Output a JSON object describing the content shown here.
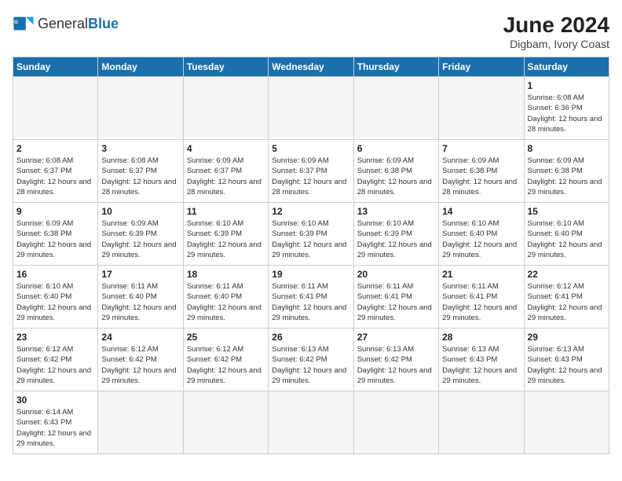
{
  "header": {
    "logo_general": "General",
    "logo_blue": "Blue",
    "title": "June 2024",
    "location": "Digbam, Ivory Coast"
  },
  "days_of_week": [
    "Sunday",
    "Monday",
    "Tuesday",
    "Wednesday",
    "Thursday",
    "Friday",
    "Saturday"
  ],
  "weeks": [
    [
      {
        "day": "",
        "info": ""
      },
      {
        "day": "",
        "info": ""
      },
      {
        "day": "",
        "info": ""
      },
      {
        "day": "",
        "info": ""
      },
      {
        "day": "",
        "info": ""
      },
      {
        "day": "",
        "info": ""
      },
      {
        "day": "1",
        "info": "Sunrise: 6:08 AM\nSunset: 6:36 PM\nDaylight: 12 hours and 28 minutes."
      }
    ],
    [
      {
        "day": "2",
        "info": "Sunrise: 6:08 AM\nSunset: 6:37 PM\nDaylight: 12 hours and 28 minutes."
      },
      {
        "day": "3",
        "info": "Sunrise: 6:08 AM\nSunset: 6:37 PM\nDaylight: 12 hours and 28 minutes."
      },
      {
        "day": "4",
        "info": "Sunrise: 6:09 AM\nSunset: 6:37 PM\nDaylight: 12 hours and 28 minutes."
      },
      {
        "day": "5",
        "info": "Sunrise: 6:09 AM\nSunset: 6:37 PM\nDaylight: 12 hours and 28 minutes."
      },
      {
        "day": "6",
        "info": "Sunrise: 6:09 AM\nSunset: 6:38 PM\nDaylight: 12 hours and 28 minutes."
      },
      {
        "day": "7",
        "info": "Sunrise: 6:09 AM\nSunset: 6:38 PM\nDaylight: 12 hours and 28 minutes."
      },
      {
        "day": "8",
        "info": "Sunrise: 6:09 AM\nSunset: 6:38 PM\nDaylight: 12 hours and 29 minutes."
      }
    ],
    [
      {
        "day": "9",
        "info": "Sunrise: 6:09 AM\nSunset: 6:38 PM\nDaylight: 12 hours and 29 minutes."
      },
      {
        "day": "10",
        "info": "Sunrise: 6:09 AM\nSunset: 6:39 PM\nDaylight: 12 hours and 29 minutes."
      },
      {
        "day": "11",
        "info": "Sunrise: 6:10 AM\nSunset: 6:39 PM\nDaylight: 12 hours and 29 minutes."
      },
      {
        "day": "12",
        "info": "Sunrise: 6:10 AM\nSunset: 6:39 PM\nDaylight: 12 hours and 29 minutes."
      },
      {
        "day": "13",
        "info": "Sunrise: 6:10 AM\nSunset: 6:39 PM\nDaylight: 12 hours and 29 minutes."
      },
      {
        "day": "14",
        "info": "Sunrise: 6:10 AM\nSunset: 6:40 PM\nDaylight: 12 hours and 29 minutes."
      },
      {
        "day": "15",
        "info": "Sunrise: 6:10 AM\nSunset: 6:40 PM\nDaylight: 12 hours and 29 minutes."
      }
    ],
    [
      {
        "day": "16",
        "info": "Sunrise: 6:10 AM\nSunset: 6:40 PM\nDaylight: 12 hours and 29 minutes."
      },
      {
        "day": "17",
        "info": "Sunrise: 6:11 AM\nSunset: 6:40 PM\nDaylight: 12 hours and 29 minutes."
      },
      {
        "day": "18",
        "info": "Sunrise: 6:11 AM\nSunset: 6:40 PM\nDaylight: 12 hours and 29 minutes."
      },
      {
        "day": "19",
        "info": "Sunrise: 6:11 AM\nSunset: 6:41 PM\nDaylight: 12 hours and 29 minutes."
      },
      {
        "day": "20",
        "info": "Sunrise: 6:11 AM\nSunset: 6:41 PM\nDaylight: 12 hours and 29 minutes."
      },
      {
        "day": "21",
        "info": "Sunrise: 6:11 AM\nSunset: 6:41 PM\nDaylight: 12 hours and 29 minutes."
      },
      {
        "day": "22",
        "info": "Sunrise: 6:12 AM\nSunset: 6:41 PM\nDaylight: 12 hours and 29 minutes."
      }
    ],
    [
      {
        "day": "23",
        "info": "Sunrise: 6:12 AM\nSunset: 6:42 PM\nDaylight: 12 hours and 29 minutes."
      },
      {
        "day": "24",
        "info": "Sunrise: 6:12 AM\nSunset: 6:42 PM\nDaylight: 12 hours and 29 minutes."
      },
      {
        "day": "25",
        "info": "Sunrise: 6:12 AM\nSunset: 6:42 PM\nDaylight: 12 hours and 29 minutes."
      },
      {
        "day": "26",
        "info": "Sunrise: 6:13 AM\nSunset: 6:42 PM\nDaylight: 12 hours and 29 minutes."
      },
      {
        "day": "27",
        "info": "Sunrise: 6:13 AM\nSunset: 6:42 PM\nDaylight: 12 hours and 29 minutes."
      },
      {
        "day": "28",
        "info": "Sunrise: 6:13 AM\nSunset: 6:43 PM\nDaylight: 12 hours and 29 minutes."
      },
      {
        "day": "29",
        "info": "Sunrise: 6:13 AM\nSunset: 6:43 PM\nDaylight: 12 hours and 29 minutes."
      }
    ],
    [
      {
        "day": "30",
        "info": "Sunrise: 6:14 AM\nSunset: 6:43 PM\nDaylight: 12 hours and 29 minutes."
      },
      {
        "day": "",
        "info": ""
      },
      {
        "day": "",
        "info": ""
      },
      {
        "day": "",
        "info": ""
      },
      {
        "day": "",
        "info": ""
      },
      {
        "day": "",
        "info": ""
      },
      {
        "day": "",
        "info": ""
      }
    ]
  ]
}
